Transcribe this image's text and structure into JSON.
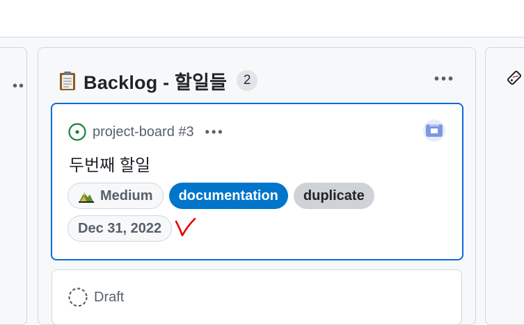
{
  "column": {
    "title": "Backlog - 할일들",
    "count": "2",
    "menu_icon": "kebab-horizontal-icon",
    "emoji_icon": "clipboard-icon"
  },
  "cards": [
    {
      "status_icon": "issue-opened-icon",
      "reference": "project-board #3",
      "title": "두번째 할일",
      "labels": [
        {
          "text": "Medium",
          "icon": "mountain-icon",
          "color": "#f6f8fa"
        },
        {
          "text": "documentation",
          "color": "#0075ca"
        },
        {
          "text": "duplicate",
          "color": "#cfd3d7"
        }
      ],
      "date": "Dec 31, 2022",
      "annotation_color": "#e00000"
    },
    {
      "status_icon": "draft-icon",
      "reference": "Draft"
    }
  ],
  "colors": {
    "accent": "#0969da",
    "issue_open": "#1a7f37"
  }
}
